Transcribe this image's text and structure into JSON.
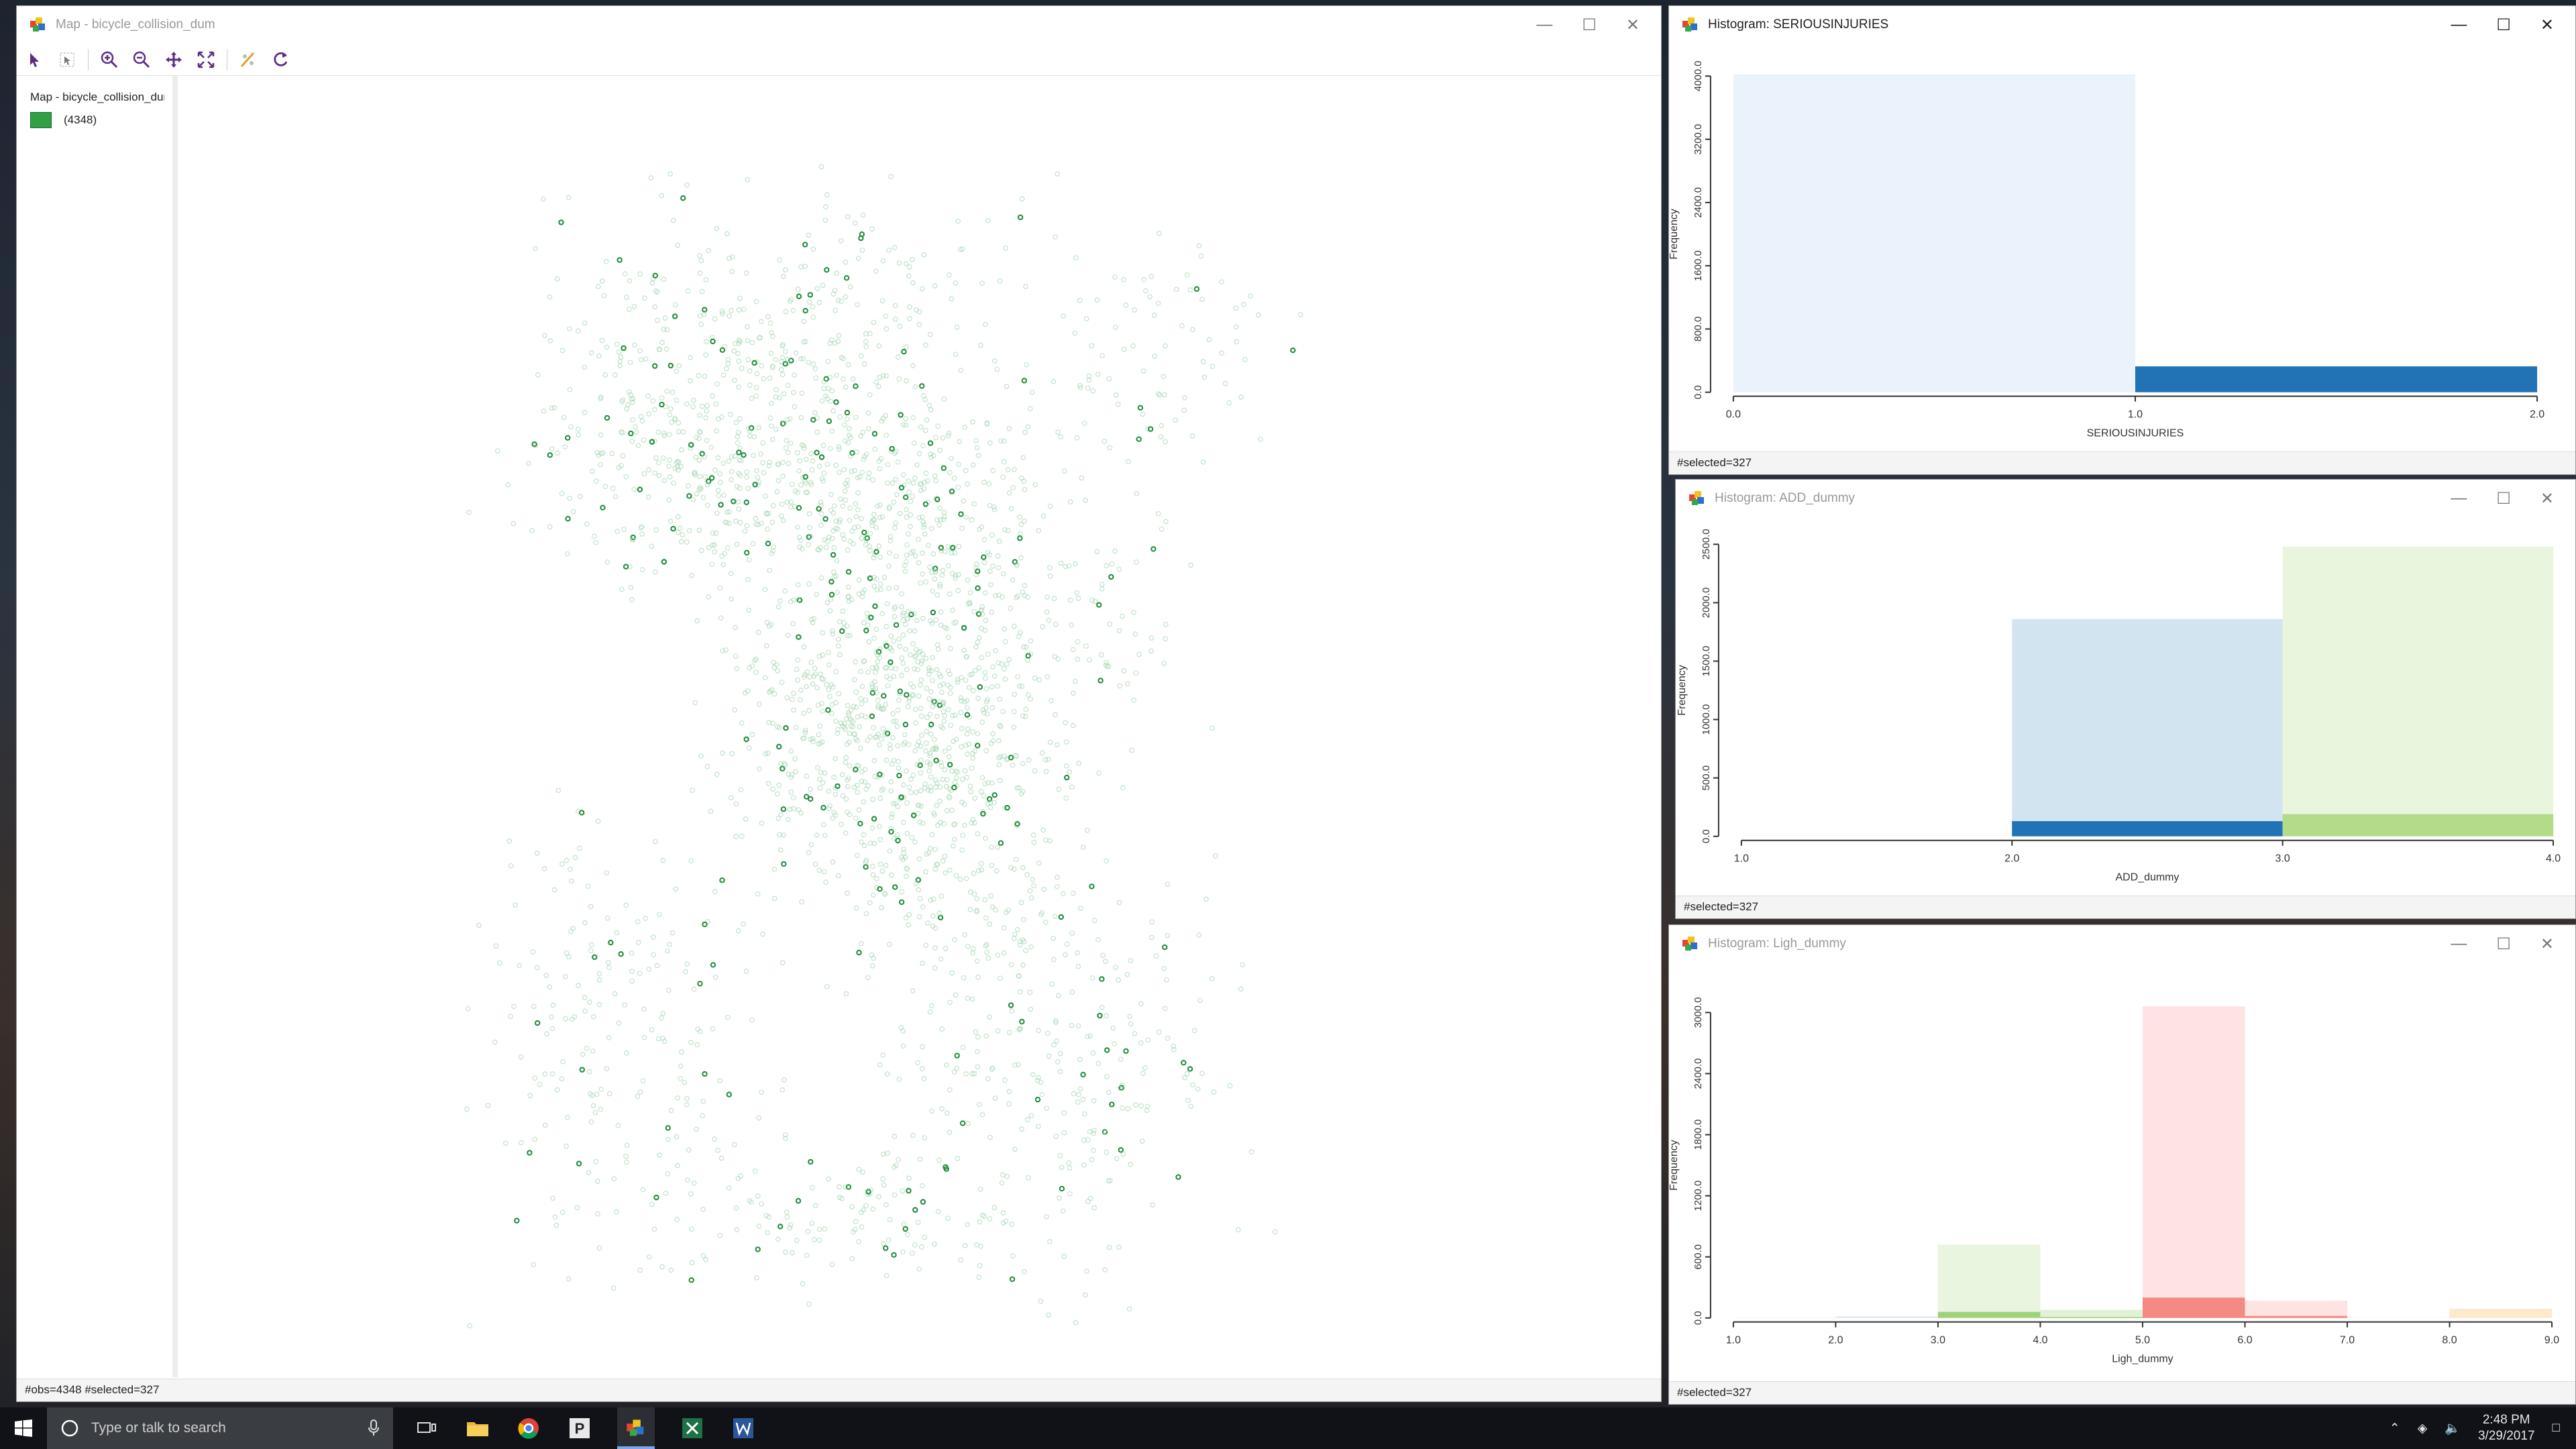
{
  "map_window": {
    "title": "Map - bicycle_collision_dum",
    "legend_title": "Map - bicycle_collision_dum",
    "legend_count": "(4348)",
    "status": "#obs=4348 #selected=327"
  },
  "hist1": {
    "title": "Histogram: SERIOUSINJURIES",
    "status": "#selected=327",
    "chart_data": {
      "type": "bar",
      "title": "",
      "xlabel": "SERIOUSINJURIES",
      "ylabel": "Frequency",
      "x_ticks": [
        "0.0",
        "1.0",
        "2.0"
      ],
      "y_ticks": [
        "0.0",
        "800.0",
        "1600.0",
        "2400.0",
        "3200.0",
        "4000.0"
      ],
      "ylim": [
        0,
        4000
      ],
      "bins": [
        [
          0,
          1
        ],
        [
          1,
          2
        ]
      ],
      "series": [
        {
          "values": [
            4020,
            328
          ],
          "color": "#eaf2fb"
        },
        {
          "values": [
            0,
            327
          ],
          "color": "#2272b6"
        }
      ]
    }
  },
  "hist2": {
    "title": "Histogram: ADD_dummy",
    "status": "#selected=327",
    "chart_data": {
      "type": "bar",
      "title": "",
      "xlabel": "ADD_dummy",
      "ylabel": "Frequency",
      "x_ticks": [
        "1.0",
        "2.0",
        "3.0",
        "4.0"
      ],
      "y_ticks": [
        "0.0",
        "500.0",
        "1000.0",
        "1500.0",
        "2000.0",
        "2500.0"
      ],
      "ylim": [
        0,
        2500
      ],
      "bins": [
        [
          1,
          2
        ],
        [
          2,
          3
        ],
        [
          3,
          4
        ]
      ],
      "series": [
        {
          "values": [
            0,
            1860,
            2480
          ],
          "colors": [
            "#d3e4f1",
            "#d3e4f1",
            "#e9f5dd"
          ]
        },
        {
          "values": [
            0,
            130,
            190
          ],
          "colors": [
            "#2272b6",
            "#2272b6",
            "#b2dc8a"
          ]
        }
      ]
    }
  },
  "hist3": {
    "title": "Histogram: Ligh_dummy",
    "status": "#selected=327",
    "chart_data": {
      "type": "bar",
      "title": "",
      "xlabel": "Ligh_dummy",
      "ylabel": "Frequency",
      "x_ticks": [
        "1.0",
        "2.0",
        "3.0",
        "4.0",
        "5.0",
        "6.0",
        "7.0",
        "8.0",
        "9.0"
      ],
      "y_ticks": [
        "0.0",
        "600.0",
        "1200.0",
        "1800.0",
        "2400.0",
        "3000.0"
      ],
      "ylim": [
        0,
        3000
      ],
      "bins": [
        [
          1,
          2
        ],
        [
          2,
          3
        ],
        [
          3,
          4
        ],
        [
          4,
          5
        ],
        [
          5,
          6
        ],
        [
          6,
          7
        ],
        [
          7,
          8
        ],
        [
          8,
          9
        ]
      ],
      "series": [
        {
          "values": [
            5,
            15,
            720,
            80,
            3060,
            170,
            5,
            90
          ],
          "colors": [
            "#eef2f7",
            "#dce8f3",
            "#eaf5df",
            "#e2f1d6",
            "#fde3e1",
            "#fde3e1",
            "#f6f6f6",
            "#fde9cc"
          ]
        },
        {
          "values": [
            0,
            0,
            60,
            10,
            200,
            20,
            0,
            0
          ],
          "colors": [
            "#2272b6",
            "#2272b6",
            "#9ed27a",
            "#9ed27a",
            "#f58a84",
            "#f58a84",
            "#bbbbbb",
            "#f4c27a"
          ]
        }
      ]
    }
  },
  "taskbar": {
    "search_placeholder": "Type or talk to search",
    "time": "2:48 PM",
    "date": "3/29/2017"
  }
}
